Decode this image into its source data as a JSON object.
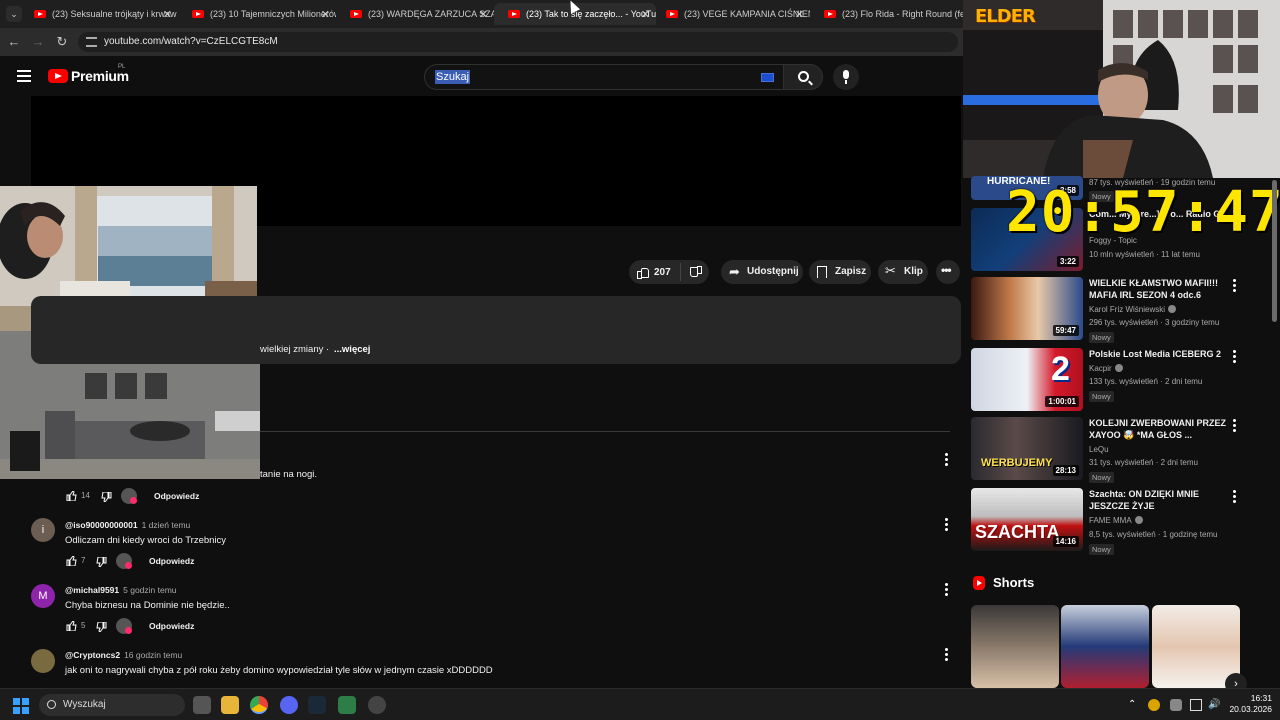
{
  "browser": {
    "tabs": [
      {
        "title": "(23) Seksualne trójkąty i krwaw"
      },
      {
        "title": "(23) 10 Tajemniczych Milionerów"
      },
      {
        "title": "(23) WARDĘGA ZARZUCA SZAL"
      },
      {
        "title": "(23) Tak to się zaczęło... - YouTu",
        "active": true
      },
      {
        "title": "(23) VEGE KAMPANIA CIŚNIENI"
      },
      {
        "title": "(23) Flo Rida - Right Round (fea"
      }
    ],
    "url": "youtube.com/watch?v=CzELCGTE8cM"
  },
  "youtube": {
    "brand": "Premium",
    "brand_region": "PL",
    "search_value": "Szukaj",
    "actions": {
      "like_count": "207",
      "share": "Udostępnij",
      "save": "Zapisz",
      "clip": "Klip"
    },
    "description": {
      "snippet": "wielkiej zmiany ·",
      "more": "...więcej"
    }
  },
  "comments": {
    "first_partial_text": "tanie na nogi.",
    "first_likes": "14",
    "reply_label": "Odpowiedz",
    "items": [
      {
        "avatar_letter": "i",
        "avatar_color": "#6b5d52",
        "author": "@iso90000000001",
        "time": "1 dzień temu",
        "text": "Odliczam dni kiedy wroci do Trzebnicy",
        "likes": "7"
      },
      {
        "avatar_letter": "M",
        "avatar_color": "#8e24aa",
        "author": "@michal9591",
        "time": "5 godzin temu",
        "text": "Chyba biznesu na Dominie nie będzie..",
        "likes": "5"
      },
      {
        "avatar_letter": "",
        "avatar_color": "#7a6a40",
        "author": "@Cryptoncs2",
        "time": "16 godzin temu",
        "text": "jak oni to nagrywali chyba z pół roku żeby domino wypowiedział tyle słów w jednym czasie xDDDDDD",
        "likes": ""
      }
    ]
  },
  "overlay": {
    "stream_logo": "ELDER",
    "clock": "20:57:47"
  },
  "sidebar": {
    "partial_top": {
      "title": "HURRICANE!",
      "duration": "3:58",
      "meta": "87 tys. wyświetleń · 19 godzin temu",
      "new": "Nowy"
    },
    "videos": [
      {
        "title": "Com... My Dre...] (Vo... Radio Cu...",
        "channel": "Foggy - Topic",
        "meta": "10 mln wyświetleń · 11 lat temu",
        "duration": "3:22",
        "new": ""
      },
      {
        "title": "WIELKIE KŁAMSTWO MAFII!!! MAFIA IRL SEZON 4 odc.6",
        "channel": "Karol Friz Wiśniewski",
        "meta": "296 tys. wyświetleń · 3 godziny temu",
        "duration": "59:47",
        "new": "Nowy"
      },
      {
        "title": "Polskie Lost Media ICEBERG 2",
        "channel": "Kacpir",
        "meta": "133 tys. wyświetleń · 2 dni temu",
        "duration": "1:00:01",
        "new": "Nowy"
      },
      {
        "title": "KOLEJNI ZWERBOWANI PRZEZ XAYOO 🤯 *MA GŁOS ...",
        "channel": "LeQu",
        "meta": "31 tys. wyświetleń · 2 dni temu",
        "duration": "28:13",
        "new": "Nowy"
      },
      {
        "title": "Szachta: ON DZIĘKI MNIE JESZCZE ŻYJE",
        "channel": "FAME MMA",
        "meta": "8,5 tys. wyświetleń · 1 godzinę temu",
        "duration": "14:16",
        "new": "Nowy"
      }
    ],
    "shorts_label": "Shorts"
  },
  "taskbar": {
    "search_placeholder": "Wyszukaj",
    "time": "16:31",
    "date": "20.03.2026"
  }
}
